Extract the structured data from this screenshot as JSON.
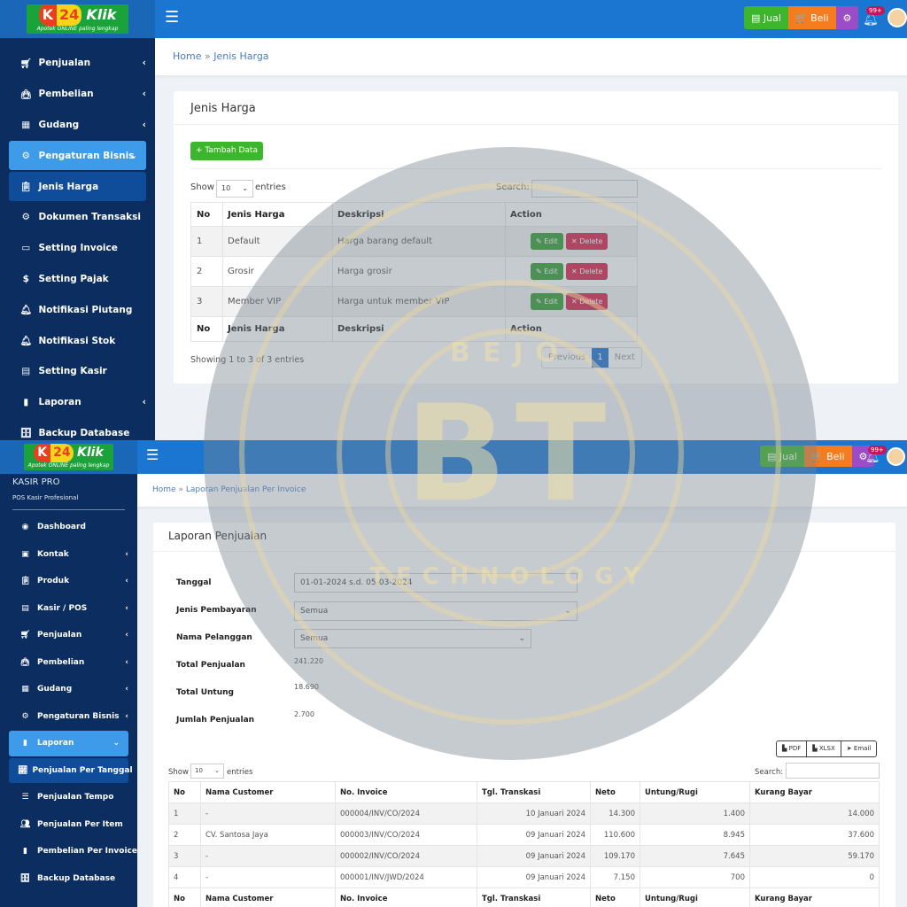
{
  "brand": {
    "logo_k": "K",
    "logo_num": "24",
    "logo_word": "Klik",
    "tagline": "Apotek ONLINE paling lengkap"
  },
  "header": {
    "jual": "Jual",
    "beli": "Beli",
    "notif_badge": "99+",
    "colors": {
      "jual": "#3db52c",
      "beli": "#f57c1f",
      "settings": "#9b4dc8"
    }
  },
  "top": {
    "sidebar": [
      {
        "label": "Penjualan",
        "icon": "cart-icon",
        "chev": "‹"
      },
      {
        "label": "Pembelian",
        "icon": "bag-icon",
        "chev": "‹"
      },
      {
        "label": "Gudang",
        "icon": "building-icon",
        "chev": "‹"
      },
      {
        "label": "Pengaturan Bisnis",
        "icon": "gears-icon",
        "chev": "⌄"
      },
      {
        "label": "Jenis Harga",
        "icon": "clipboard-icon"
      },
      {
        "label": "Dokumen Transaksi",
        "icon": "gear-icon"
      },
      {
        "label": "Setting Invoice",
        "icon": "invoice-icon"
      },
      {
        "label": "Setting Pajak",
        "icon": "dollar-icon"
      },
      {
        "label": "Notifikasi Piutang",
        "icon": "bell-icon"
      },
      {
        "label": "Notifikasi Stok",
        "icon": "bell-icon"
      },
      {
        "label": "Setting Kasir",
        "icon": "cashier-icon"
      },
      {
        "label": "Laporan",
        "icon": "book-icon",
        "chev": "‹"
      },
      {
        "label": "Backup Database",
        "icon": "database-icon"
      }
    ],
    "breadcrumb": {
      "home": "Home",
      "sep": "»",
      "current": "Jenis Harga"
    },
    "card_title": "Jenis Harga",
    "add_button": "Tambah Data",
    "show": "Show",
    "entries_value": "10",
    "entries": "entries",
    "search": "Search:",
    "columns": [
      "No",
      "Jenis Harga",
      "Deskripsi",
      "Action"
    ],
    "rows": [
      {
        "no": "1",
        "name": "Default",
        "desc": "Harga barang default"
      },
      {
        "no": "2",
        "name": "Grosir",
        "desc": "Harga grosir"
      },
      {
        "no": "3",
        "name": "Member VIP",
        "desc": "Harga untuk member VIP"
      }
    ],
    "edit": "Edit",
    "delete": "Delete",
    "info": "Showing 1 to 3 of 3 entries",
    "pager": {
      "prev": "Previous",
      "page": "1",
      "next": "Next"
    }
  },
  "bottom": {
    "app_name": "KASIR PRO",
    "app_sub": "POS Kasir Profesional",
    "sidebar": [
      {
        "label": "Dashboard",
        "icon": "dashboard-icon"
      },
      {
        "label": "Kontak",
        "icon": "contact-icon",
        "chev": "‹"
      },
      {
        "label": "Produk",
        "icon": "clipboard-icon",
        "chev": "‹"
      },
      {
        "label": "Kasir / POS",
        "icon": "cash-register-icon",
        "chev": "‹"
      },
      {
        "label": "Penjualan",
        "icon": "cart-icon",
        "chev": "‹"
      },
      {
        "label": "Pembelian",
        "icon": "bag-icon",
        "chev": "‹"
      },
      {
        "label": "Gudang",
        "icon": "building-icon",
        "chev": "‹"
      },
      {
        "label": "Pengaturan Bisnis",
        "icon": "gears-icon",
        "chev": "‹"
      },
      {
        "label": "Laporan",
        "icon": "book-icon",
        "chev": "⌄"
      },
      {
        "label": "Penjualan Per Tanggal",
        "icon": "chart-line-icon"
      },
      {
        "label": "Penjualan Tempo",
        "icon": "list-icon"
      },
      {
        "label": "Penjualan Per Item",
        "icon": "users-icon"
      },
      {
        "label": "Pembelian Per Invoice",
        "icon": "file-icon"
      },
      {
        "label": "Backup Database",
        "icon": "database-icon"
      }
    ],
    "breadcrumb": {
      "home": "Home",
      "sep": "»",
      "current": "Laporan Penjualan Per Invoice"
    },
    "card_title": "Laporan Penjualan",
    "form": {
      "tanggal_label": "Tanggal",
      "tanggal_value": "01-01-2024 s.d. 05-03-2024",
      "jenis_label": "Jenis Pembayaran",
      "jenis_value": "Semua",
      "pelanggan_label": "Nama Pelanggan",
      "pelanggan_value": "Semua",
      "total_penjualan_label": "Total Penjualan",
      "total_penjualan": "241.220",
      "total_untung_label": "Total Untung",
      "total_untung": "18.690",
      "jumlah_label": "Jumlah Penjualan",
      "jumlah": "2.700"
    },
    "export": {
      "pdf": "PDF",
      "xlsx": "XLSX",
      "email": "Email"
    },
    "show": "Show",
    "entries_value": "10",
    "entries": "entries",
    "search": "Search:",
    "columns": [
      "No",
      "Nama Customer",
      "No. Invoice",
      "Tgl. Transkasi",
      "Neto",
      "Untung/Rugi",
      "Kurang Bayar"
    ],
    "rows": [
      [
        "1",
        "-",
        "000004/INV/CO/2024",
        "10 Januari 2024",
        "14.300",
        "1.400",
        "14.000"
      ],
      [
        "2",
        "CV. Santosa Jaya",
        "000003/INV/CO/2024",
        "09 Januari 2024",
        "110.600",
        "8.945",
        "37.600"
      ],
      [
        "3",
        "-",
        "000002/INV/CO/2024",
        "09 Januari 2024",
        "109.170",
        "7.645",
        "59.170"
      ],
      [
        "4",
        "-",
        "000001/INV/JWD/2024",
        "09 Januari 2024",
        "7.150",
        "700",
        "0"
      ]
    ]
  },
  "watermark": {
    "letters": "BT",
    "top_text": "BEJO",
    "bottom_text": "TECHNOLOGY"
  }
}
